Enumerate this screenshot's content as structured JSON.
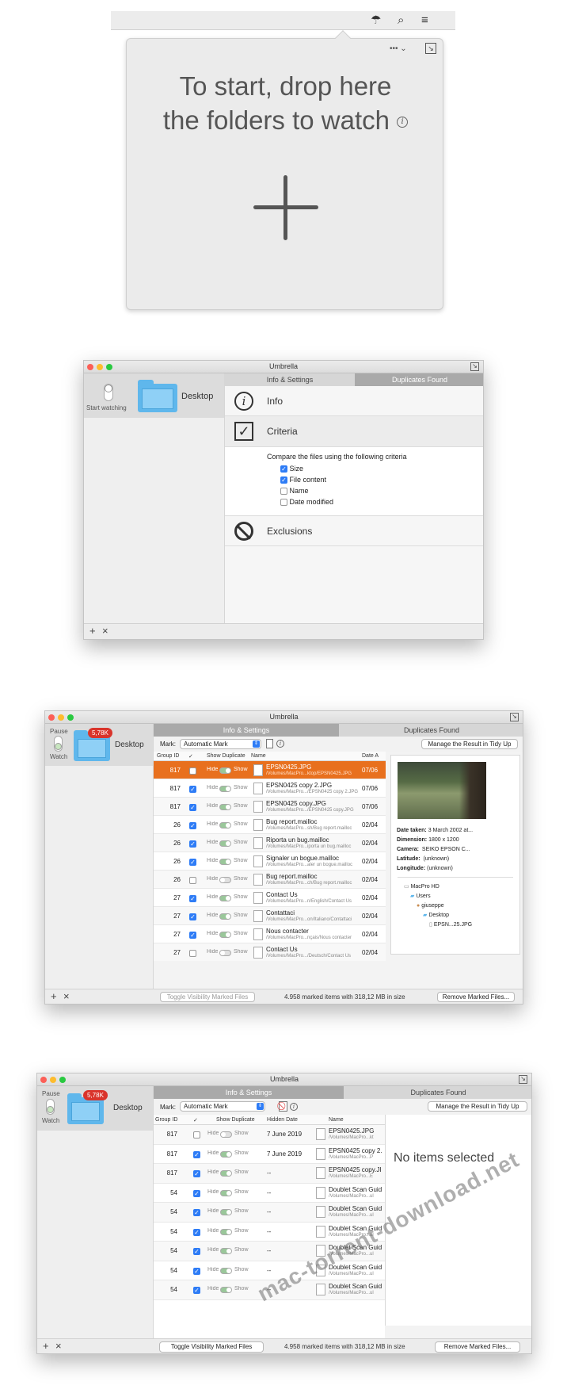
{
  "menubar": {
    "icons": [
      "umbrella-icon",
      "search-icon",
      "list-icon"
    ],
    "umbrella": "☂",
    "search": "⌕",
    "list": "≡"
  },
  "popover": {
    "menu_dots": "••• ⌄",
    "title_line1": "To start, drop here",
    "title_line2": "the folders to watch",
    "info": "i",
    "plus": "+"
  },
  "window_settings": {
    "title": "Umbrella",
    "sidebar": {
      "switch_label": "Start watching",
      "folder_name": "Desktop"
    },
    "tabs": [
      "Info & Settings",
      "Duplicates Found"
    ],
    "sections": {
      "info": "Info",
      "criteria": "Criteria",
      "exclusions": "Exclusions"
    },
    "criteria_intro": "Compare the files using the following criteria",
    "criteria": [
      {
        "label": "Size",
        "checked": true
      },
      {
        "label": "File content",
        "checked": true
      },
      {
        "label": "Name",
        "checked": false
      },
      {
        "label": "Date modified",
        "checked": false
      }
    ],
    "bottom": {
      "add": "+",
      "remove": "×"
    }
  },
  "window_duplicates": {
    "title": "Umbrella",
    "sidebar": {
      "pause": "Pause",
      "watch": "Watch",
      "badge": "5,78K",
      "folder_name": "Desktop"
    },
    "tabs": [
      "Info & Settings",
      "Duplicates Found"
    ],
    "toolbar": {
      "mark_label": "Mark:",
      "mark_value": "Automatic Mark",
      "manage_button": "Manage the Result in Tidy Up"
    },
    "columns": [
      "Group ID",
      "✓",
      "Show Duplicate",
      "Name",
      "Date A"
    ],
    "rows": [
      {
        "group": "817",
        "checked": false,
        "hide": "Hide",
        "show": "Show",
        "name": "EPSN0425.JPG",
        "path": "/Volumes/MacPro...ktop/EPSN0425.JPG",
        "date": "07/06",
        "selected": true
      },
      {
        "group": "817",
        "checked": true,
        "hide": "Hide",
        "show": "Show",
        "name": "EPSN0425 copy 2.JPG",
        "path": "/Volumes/MacPro.../EPSN0425 copy 2.JPG",
        "date": "07/06"
      },
      {
        "group": "817",
        "checked": true,
        "hide": "Hide",
        "show": "Show",
        "name": "EPSN0425 copy.JPG",
        "path": "/Volumes/MacPro.../EPSN0425 copy.JPG",
        "date": "07/06"
      },
      {
        "group": "26",
        "checked": true,
        "hide": "Hide",
        "show": "Show",
        "name": "Bug report.mailloc",
        "path": "/Volumes/MacPro...sh/Bug report.mailloc",
        "date": "02/04"
      },
      {
        "group": "26",
        "checked": true,
        "hide": "Hide",
        "show": "Show",
        "name": "Riporta un bug.mailloc",
        "path": "/Volumes/MacPro...iporta un bug.mailloc",
        "date": "02/04"
      },
      {
        "group": "26",
        "checked": true,
        "hide": "Hide",
        "show": "Show",
        "name": "Signaler un bogue.mailloc",
        "path": "/Volumes/MacPro...aler un bogue.mailloc",
        "date": "02/04"
      },
      {
        "group": "26",
        "checked": false,
        "hide": "Hide",
        "show": "Show",
        "name": "Bug report.mailloc",
        "path": "/Volumes/MacPro...ch/Bug report.mailloc",
        "date": "02/04"
      },
      {
        "group": "27",
        "checked": true,
        "hide": "Hide",
        "show": "Show",
        "name": "Contact Us",
        "path": "/Volumes/MacPro...n/English/Contact Us",
        "date": "02/04"
      },
      {
        "group": "27",
        "checked": true,
        "hide": "Hide",
        "show": "Show",
        "name": "Contattaci",
        "path": "/Volumes/MacPro...on/Italiano/Contattaci",
        "date": "02/04"
      },
      {
        "group": "27",
        "checked": true,
        "hide": "Hide",
        "show": "Show",
        "name": "Nous contacter",
        "path": "/Volumes/MacPro...nçais/Nous contacter",
        "date": "02/04"
      },
      {
        "group": "27",
        "checked": false,
        "hide": "Hide",
        "show": "Show",
        "name": "Contact Us",
        "path": "/Volumes/MacPro.../Deutsch/Contact Us",
        "date": "02/04"
      }
    ],
    "details": {
      "date_taken_label": "Date taken:",
      "date_taken": "3 March 2002 at...",
      "dimension_label": "Dimension:",
      "dimension": "1800 x 1200",
      "camera_label": "Camera:",
      "camera": "SEIKO EPSON C...",
      "latitude_label": "Latitude:",
      "latitude": "(unknown)",
      "longitude_label": "Longitude:",
      "longitude": "(unknown)",
      "tree": [
        "MacPro HD",
        "Users",
        "giuseppe",
        "Desktop",
        "EPSN...25.JPG"
      ]
    },
    "bottom": {
      "add": "+",
      "remove": "×",
      "toggle": "Toggle Visibility Marked Files",
      "status": "4.958 marked items with 318,12 MB in size",
      "remove_button": "Remove Marked Files..."
    }
  },
  "window_hidden": {
    "title": "Umbrella",
    "sidebar": {
      "pause": "Pause",
      "watch": "Watch",
      "badge": "5,78K",
      "folder_name": "Desktop"
    },
    "tabs": [
      "Info & Settings",
      "Duplicates Found"
    ],
    "toolbar": {
      "mark_label": "Mark:",
      "mark_value": "Automatic Mark",
      "manage_button": "Manage the Result in Tidy Up"
    },
    "columns": [
      "Group ID",
      "✓",
      "Show Duplicate",
      "Hidden Date",
      "Name"
    ],
    "rows": [
      {
        "group": "817",
        "checked": false,
        "hide": "Hide",
        "show": "Show",
        "hidden_date": "7 June 2019",
        "name": "EPSN0425.JPG",
        "path": "/Volumes/MacPro...kt"
      },
      {
        "group": "817",
        "checked": true,
        "hide": "Hide",
        "show": "Show",
        "hidden_date": "7 June 2019",
        "name": "EPSN0425 copy 2.",
        "path": "/Volumes/MacPro...P"
      },
      {
        "group": "817",
        "checked": true,
        "hide": "Hide",
        "show": "Show",
        "hidden_date": "--",
        "name": "EPSN0425 copy.JI",
        "path": "/Volumes/MacPro...E"
      },
      {
        "group": "54",
        "checked": true,
        "hide": "Hide",
        "show": "Show",
        "hidden_date": "--",
        "name": "Doublet Scan Guid",
        "path": "/Volumes/MacPro...ul"
      },
      {
        "group": "54",
        "checked": true,
        "hide": "Hide",
        "show": "Show",
        "hidden_date": "--",
        "name": "Doublet Scan Guid",
        "path": "/Volumes/MacPro...ul"
      },
      {
        "group": "54",
        "checked": true,
        "hide": "Hide",
        "show": "Show",
        "hidden_date": "--",
        "name": "Doublet Scan Guid",
        "path": "/Volumes/MacPro...ul"
      },
      {
        "group": "54",
        "checked": true,
        "hide": "Hide",
        "show": "Show",
        "hidden_date": "--",
        "name": "Doublet Scan Guid",
        "path": "/Volumes/MacPro...ul"
      },
      {
        "group": "54",
        "checked": true,
        "hide": "Hide",
        "show": "Show",
        "hidden_date": "--",
        "name": "Doublet Scan Guid",
        "path": "/Volumes/MacPro...ul"
      },
      {
        "group": "54",
        "checked": true,
        "hide": "Hide",
        "show": "Show",
        "hidden_date": "--",
        "name": "Doublet Scan Guid",
        "path": "/Volumes/MacPro...ul"
      }
    ],
    "empty_detail": "No items selected",
    "bottom": {
      "add": "+",
      "remove": "×",
      "toggle": "Toggle Visibility Marked Files",
      "status": "4.958 marked items with 318,12 MB in size",
      "remove_button": "Remove Marked Files..."
    }
  },
  "watermark": "mac-torrent-download.net"
}
